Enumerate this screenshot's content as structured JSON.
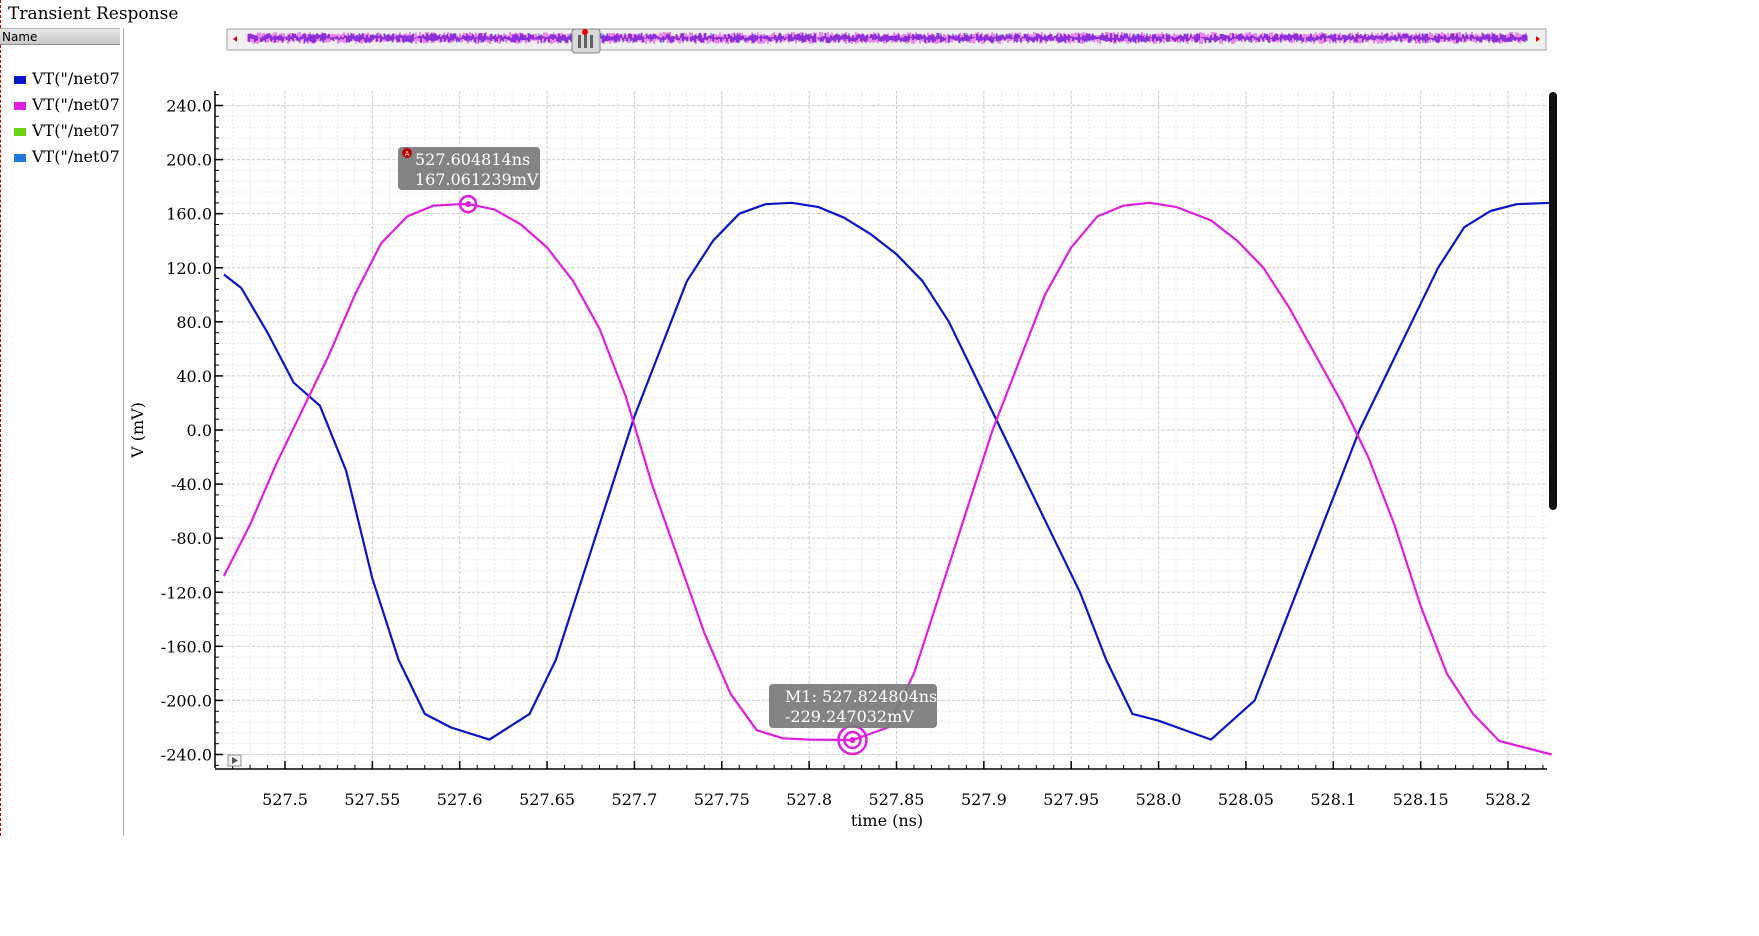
{
  "window": {
    "title": "Transient Response"
  },
  "sidebar": {
    "header": "Name",
    "items": [
      {
        "label": "VT(\"/net07",
        "color": "#0a14c8"
      },
      {
        "label": "VT(\"/net07",
        "color": "#e01ee0"
      },
      {
        "label": "VT(\"/net07",
        "color": "#6ad414"
      },
      {
        "label": "VT(\"/net07",
        "color": "#1e78dc"
      }
    ]
  },
  "chart_data": {
    "type": "line",
    "xlabel": "time (ns)",
    "ylabel": "V (mV)",
    "xlim": [
      527.465,
      528.225
    ],
    "ylim": [
      -250,
      250
    ],
    "xticks": [
      527.5,
      527.55,
      527.6,
      527.65,
      527.7,
      527.75,
      527.8,
      527.85,
      527.9,
      527.95,
      528.0,
      528.05,
      528.1,
      528.15,
      528.2
    ],
    "xtick_labels": [
      "527.5",
      "527.55",
      "527.6",
      "527.65",
      "527.7",
      "527.75",
      "527.8",
      "527.85",
      "527.9",
      "527.95",
      "528.0",
      "528.05",
      "528.1",
      "528.15",
      "528.2"
    ],
    "yticks": [
      240,
      200,
      160,
      120,
      80,
      40,
      0,
      -40,
      -80,
      -120,
      -160,
      -200,
      -240
    ],
    "ytick_labels": [
      "240.0",
      "200.0",
      "160.0",
      "120.0",
      "80.0",
      "40.0",
      "0.0",
      "-40.0",
      "-80.0",
      "-120.0",
      "-160.0",
      "-200.0",
      "-240.0"
    ],
    "grid": true,
    "series": [
      {
        "color": "#0a14c8",
        "x": [
          527.465,
          527.475,
          527.49,
          527.505,
          527.52,
          527.535,
          527.55,
          527.565,
          527.58,
          527.595,
          527.617,
          527.64,
          527.655,
          527.67,
          527.685,
          527.7,
          527.715,
          527.73,
          527.745,
          527.76,
          527.775,
          527.79,
          527.805,
          527.82,
          527.835,
          527.85,
          527.865,
          527.88,
          527.895,
          527.91,
          527.925,
          527.94,
          527.955,
          527.97,
          527.985,
          528.0,
          528.03,
          528.055,
          528.07,
          528.085,
          528.1,
          528.115,
          528.13,
          528.145,
          528.16,
          528.175,
          528.19,
          528.205,
          528.225
        ],
        "y": [
          115,
          105,
          72,
          35,
          18,
          -30,
          -110,
          -170,
          -210,
          -220,
          -229,
          -210,
          -170,
          -110,
          -50,
          10,
          60,
          110,
          140,
          160,
          167,
          168,
          165,
          157,
          145,
          130,
          110,
          80,
          40,
          0,
          -40,
          -80,
          -120,
          -170,
          -210,
          -215,
          -229,
          -200,
          -150,
          -100,
          -50,
          0,
          40,
          80,
          120,
          150,
          162,
          167,
          168
        ]
      },
      {
        "color": "#e01ee0",
        "x": [
          527.465,
          527.48,
          527.495,
          527.51,
          527.525,
          527.54,
          527.555,
          527.57,
          527.585,
          527.6,
          527.605,
          527.62,
          527.635,
          527.65,
          527.665,
          527.68,
          527.695,
          527.71,
          527.725,
          527.74,
          527.755,
          527.77,
          527.785,
          527.8,
          527.825,
          527.845,
          527.86,
          527.875,
          527.89,
          527.905,
          527.92,
          527.935,
          527.95,
          527.965,
          527.98,
          527.995,
          528.01,
          528.03,
          528.045,
          528.06,
          528.075,
          528.09,
          528.105,
          528.12,
          528.135,
          528.15,
          528.165,
          528.18,
          528.195,
          528.225
        ],
        "y": [
          -108,
          -70,
          -25,
          15,
          55,
          100,
          138,
          158,
          166,
          167,
          167.06,
          163,
          152,
          135,
          110,
          75,
          25,
          -40,
          -95,
          -150,
          -195,
          -222,
          -228,
          -229,
          -229.25,
          -220,
          -180,
          -120,
          -60,
          0,
          50,
          100,
          135,
          158,
          166,
          168,
          165,
          155,
          140,
          120,
          90,
          55,
          20,
          -20,
          -70,
          -130,
          -180,
          -210,
          -230,
          -240
        ]
      }
    ],
    "markers": [
      {
        "label": "527.604814ns",
        "label2": "167.061239mV",
        "x": 527.604814,
        "y": 167.061239,
        "flag": "A"
      },
      {
        "label": "M1: 527.824804ns",
        "label2": "-229.247032mV",
        "x": 527.824804,
        "y": -229.247032
      }
    ]
  }
}
